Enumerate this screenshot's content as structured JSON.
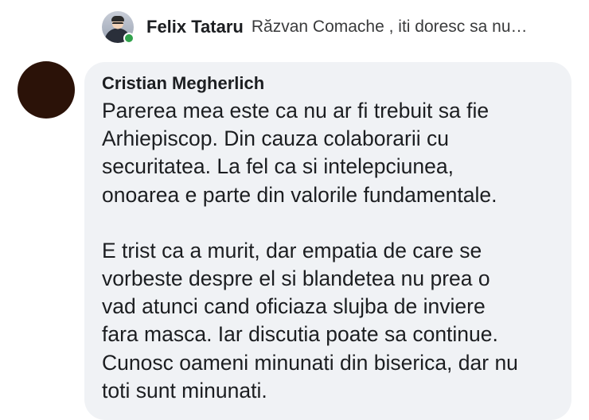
{
  "reply_preview": {
    "author": "Felix Tataru",
    "text": "Răzvan Comache , iti doresc sa nu…",
    "avatar_icon": "profile-photo-icon",
    "online_status": "online",
    "online_color": "#31a24c"
  },
  "comment": {
    "avatar_icon": "profile-photo-icon",
    "avatar_color": "#2b1208",
    "author": "Cristian Megherlich",
    "paragraphs": [
      "Parerea mea este ca nu ar fi trebuit sa fie\nArhiepiscop. Din cauza colaborarii cu\nsecuritatea. La fel ca si intelepciunea,\nonoarea e parte din valorile fundamentale.",
      "E trist ca a murit, dar empatia de care se\nvorbeste despre el si blandetea nu prea o\nvad atunci cand oficiaza slujba de inviere\nfara masca. Iar discutia poate sa continue.\nCunosc oameni minunati din biserica, dar nu\ntoti sunt minunati."
    ],
    "bubble_color": "#f0f2f5"
  }
}
